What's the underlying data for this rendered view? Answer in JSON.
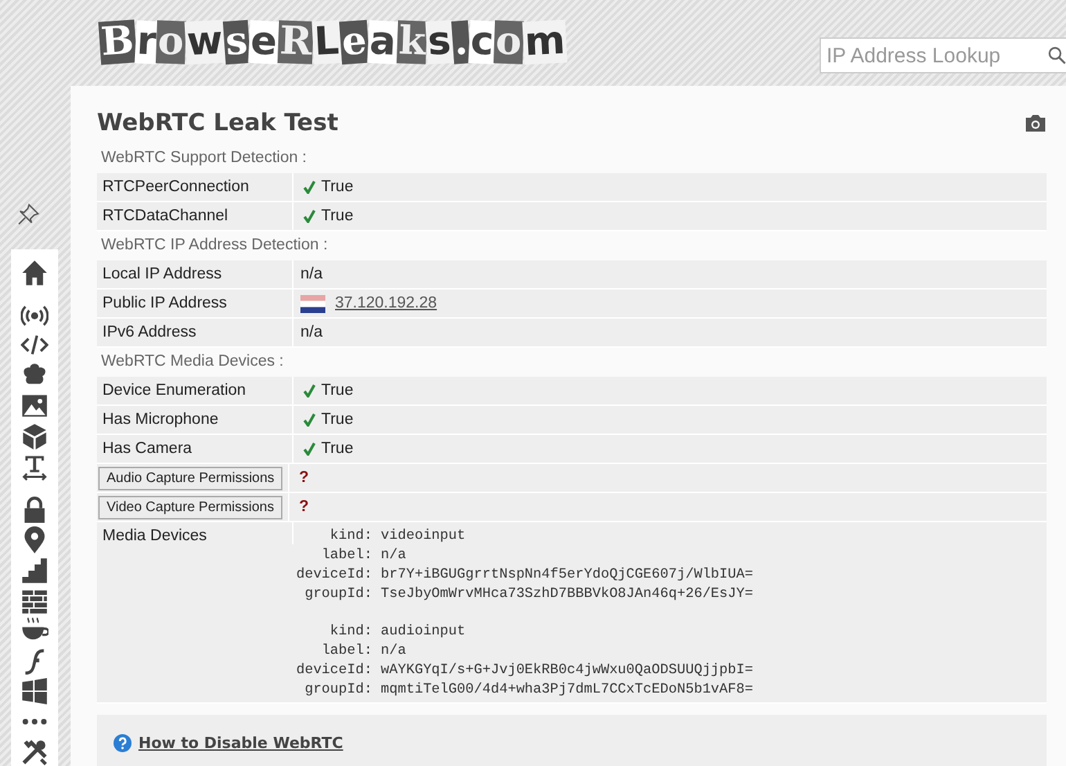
{
  "header": {
    "logo_letters": [
      "B",
      "r",
      "o",
      "w",
      "s",
      "e",
      "R",
      "L",
      "e",
      "a",
      "k",
      "s",
      ".",
      "c",
      "o",
      "m"
    ],
    "search": {
      "placeholder": "IP Address Lookup"
    }
  },
  "page": {
    "title": "WebRTC Leak Test",
    "sections": [
      {
        "heading": "WebRTC Support Detection :",
        "rows": [
          {
            "kind": "check",
            "label": "RTCPeerConnection",
            "value": "True"
          },
          {
            "kind": "check",
            "label": "RTCDataChannel",
            "value": "True"
          }
        ]
      },
      {
        "heading": "WebRTC IP Address Detection :",
        "rows": [
          {
            "kind": "text",
            "label": "Local IP Address",
            "value": "n/a"
          },
          {
            "kind": "ip",
            "label": "Public IP Address",
            "value": "37.120.192.28"
          },
          {
            "kind": "text",
            "label": "IPv6 Address",
            "value": "n/a"
          }
        ]
      },
      {
        "heading": "WebRTC Media Devices :",
        "rows": [
          {
            "kind": "check",
            "label": "Device Enumeration",
            "value": "True"
          },
          {
            "kind": "check",
            "label": "Has Microphone",
            "value": "True"
          },
          {
            "kind": "check",
            "label": "Has Camera",
            "value": "True"
          },
          {
            "kind": "button",
            "label": "Audio Capture Permissions",
            "value": "?"
          },
          {
            "kind": "button",
            "label": "Video Capture Permissions",
            "value": "?"
          },
          {
            "kind": "devices",
            "label": "Media Devices",
            "devices": [
              [
                {
                  "key": "kind:",
                  "value": "videoinput"
                },
                {
                  "key": "label:",
                  "value": "n/a"
                },
                {
                  "key": "deviceId:",
                  "value": "br7Y+iBGUGgrrtNspNn4f5erYdoQjCGE607j/WlbIUA="
                },
                {
                  "key": "groupId:",
                  "value": "TseJbyOmWrvMHca73SzhD7BBBVkO8JAn46q+26/EsJY="
                }
              ],
              [
                {
                  "key": "kind:",
                  "value": "audioinput"
                },
                {
                  "key": "label:",
                  "value": "n/a"
                },
                {
                  "key": "deviceId:",
                  "value": "wAYKGYqI/s+G+Jvj0EkRB0c4jwWxu0QaODSUUQjjpbI="
                },
                {
                  "key": "groupId:",
                  "value": "mqmtiTelG00/4d4+wha3Pj7dmL7CCxTcEDoN5b1vAF8="
                }
              ]
            ]
          }
        ]
      }
    ],
    "footer_link": "How to Disable WebRTC"
  }
}
